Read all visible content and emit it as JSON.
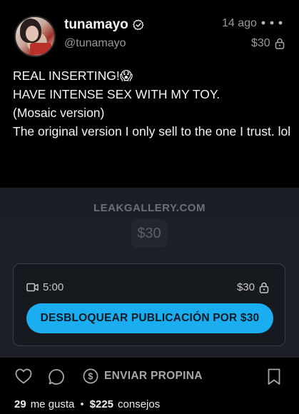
{
  "post": {
    "author_name": "tunamayo",
    "author_handle": "@tunamayo",
    "time": "14 ago",
    "price": "$30",
    "text_lines": [
      "REAL INSERTING!😱",
      "HAVE INTENSE SEX WITH MY TOY.",
      "(Mosaic version)",
      "",
      "The original version I only sell to the one I trust. lol"
    ]
  },
  "media": {
    "watermark": "LEAKGALLERY.COM",
    "price_preview": "$30",
    "duration": "5:00",
    "price": "$30",
    "unlock_label": "DESBLOQUEAR PUBLICACIÓN POR $30"
  },
  "actions": {
    "tip_label": "ENVIAR PROPINA"
  },
  "stats": {
    "likes_count": "29",
    "likes_label": "me gusta",
    "tips_amount": "$225",
    "tips_label": "consejos"
  },
  "colors": {
    "accent": "#1aaef0",
    "background": "#000000",
    "muted_text": "#9a9a9a"
  },
  "icons": [
    "verified-icon",
    "more-icon",
    "lock-icon",
    "video-icon",
    "heart-icon",
    "comment-icon",
    "dollar-icon",
    "bookmark-icon"
  ]
}
